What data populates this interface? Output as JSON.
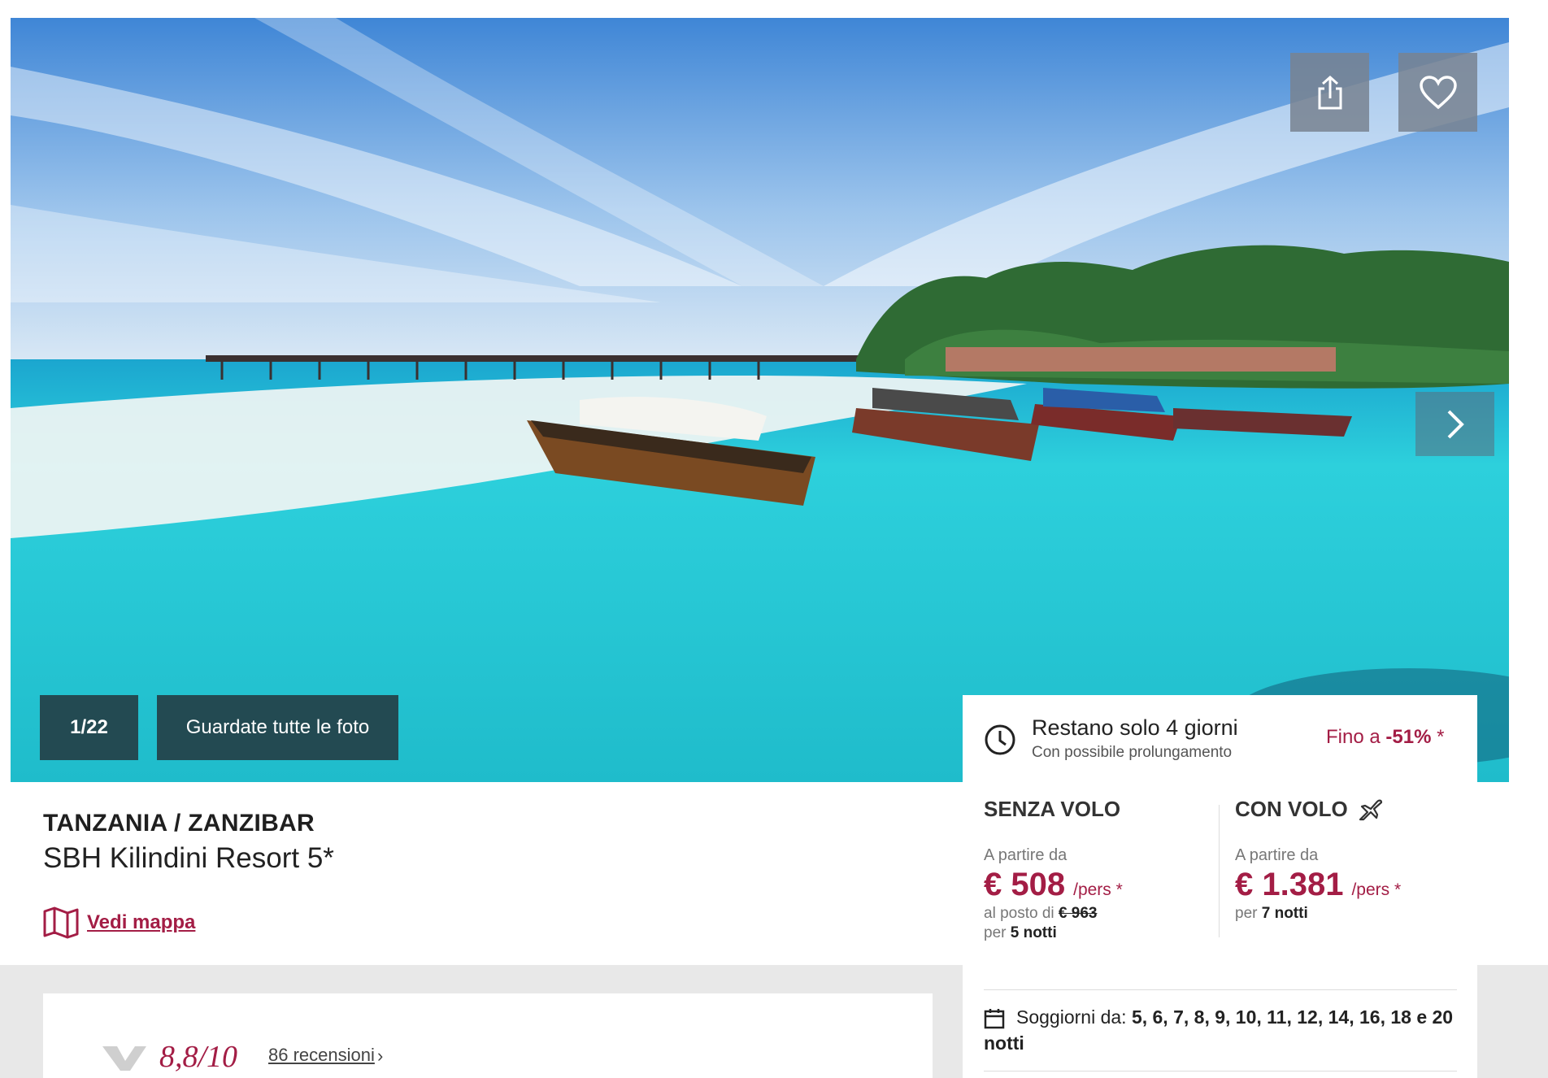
{
  "gallery": {
    "counter": "1/22",
    "view_all_label": "Guardate tutte le foto",
    "share_icon": "share-icon",
    "favorite_icon": "heart-icon",
    "next_icon": "chevron-right-icon"
  },
  "hotel": {
    "destination": "TANZANIA / ZANZIBAR",
    "name": "SBH Kilindini Resort 5*",
    "map_label": "Vedi mappa",
    "rating": "8,8/10",
    "reviews_label": "86 recensioni"
  },
  "offer": {
    "remaining": "Restano solo 4 giorni",
    "extension": "Con possibile prolungamento",
    "discount_prefix": "Fino a ",
    "discount_value": "-51%",
    "discount_suffix": " *",
    "without_flight": {
      "title": "SENZA VOLO",
      "from_label": "A partire da",
      "price": "€ 508",
      "per": "/pers *",
      "instead_label": "al posto di ",
      "old_price": "€ 963",
      "nights_prefix": "per ",
      "nights": "5 notti"
    },
    "with_flight": {
      "title": "CON VOLO",
      "from_label": "A partire da",
      "price": "€ 1.381",
      "per": "/pers *",
      "nights_prefix": "per ",
      "nights": "7 notti"
    },
    "stays_label": "Soggiorni da: ",
    "stays_values": "5, 6, 7, 8, 9, 10, 11, 12, 14, 16, 18 e 20 notti"
  },
  "colors": {
    "brand": "#a31d45",
    "gallery_button": "#234a52"
  }
}
